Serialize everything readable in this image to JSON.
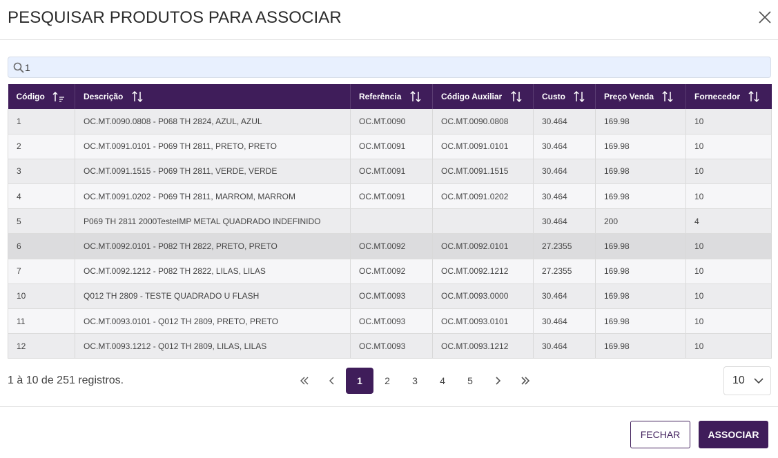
{
  "dialog": {
    "title": "PESQUISAR PRODUTOS PARA ASSOCIAR"
  },
  "search": {
    "value": "1",
    "placeholder": ""
  },
  "table": {
    "columns": [
      {
        "label": "Código"
      },
      {
        "label": "Descrição"
      },
      {
        "label": "Referência"
      },
      {
        "label": "Código Auxiliar"
      },
      {
        "label": "Custo"
      },
      {
        "label": "Preço Venda"
      },
      {
        "label": "Fornecedor"
      }
    ],
    "rows": [
      [
        "1",
        "OC.MT.0090.0808 - P068 TH 2824, AZUL, AZUL",
        "OC.MT.0090",
        "OC.MT.0090.0808",
        "30.464",
        "169.98",
        "10"
      ],
      [
        "2",
        "OC.MT.0091.0101 - P069 TH 2811, PRETO, PRETO",
        "OC.MT.0091",
        "OC.MT.0091.0101",
        "30.464",
        "169.98",
        "10"
      ],
      [
        "3",
        "OC.MT.0091.1515 - P069 TH 2811, VERDE, VERDE",
        "OC.MT.0091",
        "OC.MT.0091.1515",
        "30.464",
        "169.98",
        "10"
      ],
      [
        "4",
        "OC.MT.0091.0202 - P069 TH 2811, MARROM, MARROM",
        "OC.MT.0091",
        "OC.MT.0091.0202",
        "30.464",
        "169.98",
        "10"
      ],
      [
        "5",
        "P069 TH 2811 2000TesteIMP METAL QUADRADO INDEFINIDO",
        "",
        "",
        "30.464",
        "200",
        "4"
      ],
      [
        "6",
        "OC.MT.0092.0101 - P082 TH 2822, PRETO, PRETO",
        "OC.MT.0092",
        "OC.MT.0092.0101",
        "27.2355",
        "169.98",
        "10"
      ],
      [
        "7",
        "OC.MT.0092.1212 - P082 TH 2822, LILAS, LILAS",
        "OC.MT.0092",
        "OC.MT.0092.1212",
        "27.2355",
        "169.98",
        "10"
      ],
      [
        "10",
        "Q012 TH 2809 - TESTE QUADRADO U FLASH",
        "OC.MT.0093",
        "OC.MT.0093.0000",
        "30.464",
        "169.98",
        "10"
      ],
      [
        "11",
        "OC.MT.0093.0101 - Q012 TH 2809, PRETO, PRETO",
        "OC.MT.0093",
        "OC.MT.0093.0101",
        "30.464",
        "169.98",
        "10"
      ],
      [
        "12",
        "OC.MT.0093.1212 - Q012 TH 2809, LILAS, LILAS",
        "OC.MT.0093",
        "OC.MT.0093.1212",
        "30.464",
        "169.98",
        "10"
      ]
    ]
  },
  "footer": {
    "info": "1 à 10 de 251 registros.",
    "pages": [
      "1",
      "2",
      "3",
      "4",
      "5"
    ],
    "active_page": "1",
    "page_size": "10"
  },
  "buttons": {
    "close_label": "FECHAR",
    "associate_label": "ASSOCIAR"
  },
  "icons": {
    "close": "close-icon",
    "search": "search-icon",
    "sort_asc": "sort-ascending-icon",
    "sort": "sort-icon",
    "first": "double-chevron-left-icon",
    "prev": "chevron-left-icon",
    "next": "chevron-right-icon",
    "last": "double-chevron-right-icon",
    "dropdown": "chevron-down-icon"
  },
  "colors": {
    "primary": "#3f1d5a",
    "search_bg": "#e8f0fe"
  }
}
